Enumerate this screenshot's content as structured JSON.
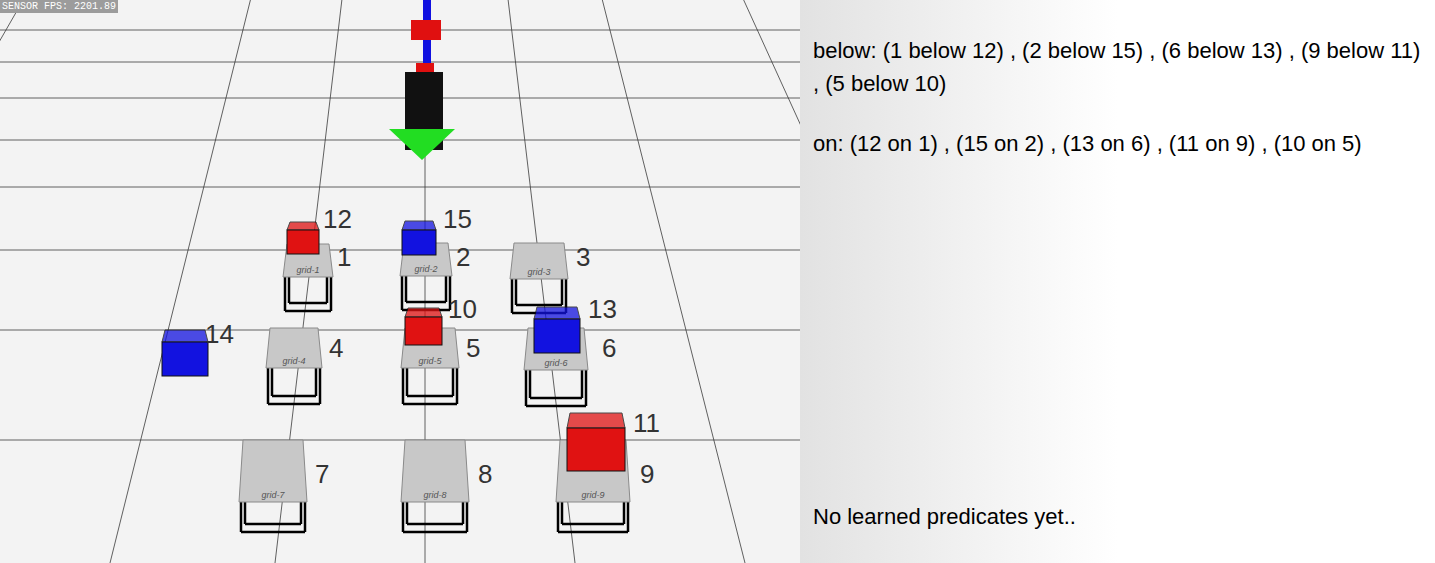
{
  "sensor": {
    "label": "SENSOR FPS: 2201.89"
  },
  "scene": {
    "tables": [
      {
        "label": "1",
        "plate": "grid-1"
      },
      {
        "label": "2",
        "plate": "grid-2"
      },
      {
        "label": "3",
        "plate": "grid-3"
      },
      {
        "label": "4",
        "plate": "grid-4"
      },
      {
        "label": "5",
        "plate": "grid-5"
      },
      {
        "label": "6",
        "plate": "grid-6"
      },
      {
        "label": "7",
        "plate": "grid-7"
      },
      {
        "label": "8",
        "plate": "grid-8"
      },
      {
        "label": "9",
        "plate": "grid-9"
      }
    ],
    "blocks": [
      {
        "label": "12",
        "color": "#e01212"
      },
      {
        "label": "15",
        "color": "#1212e0"
      },
      {
        "label": "14",
        "color": "#1212e0"
      },
      {
        "label": "10",
        "color": "#e01212"
      },
      {
        "label": "13",
        "color": "#1212e0"
      },
      {
        "label": "11",
        "color": "#e01212"
      }
    ]
  },
  "panel": {
    "relations": [
      {
        "text": "below: (1 below 12) , (2 below 15) , (6 below 13) , (9 below 11) , (5 below 10)"
      },
      {
        "text": "on: (12 on 1) , (15 on 2) , (13 on 6) , (11 on 9) , (10 on 5)"
      }
    ],
    "footer": "No learned predicates yet.."
  }
}
